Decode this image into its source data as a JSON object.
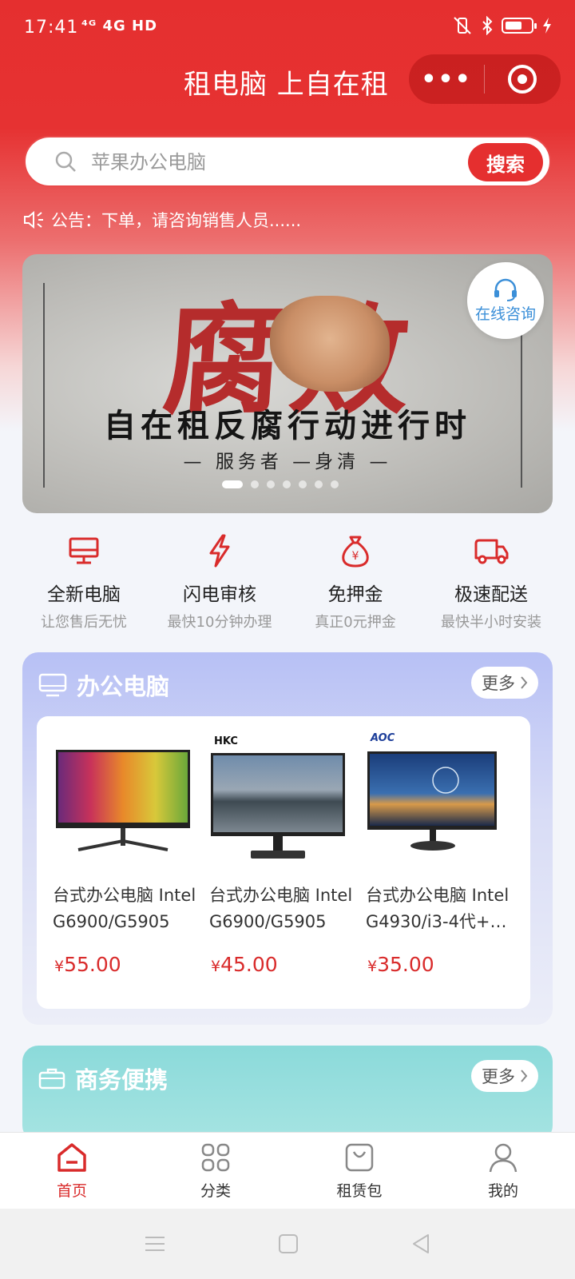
{
  "status_bar": {
    "time": "17:41",
    "network": "⁴ᴳ 4G HD",
    "colors": {
      "bg": "#e52f2f"
    }
  },
  "nav": {
    "title": "租电脑 上自在租",
    "more_glyph": "•••"
  },
  "search": {
    "placeholder": "苹果办公电脑",
    "button_label": "搜索"
  },
  "notice": {
    "text": "公告：下单，请咨询销售人员......"
  },
  "banner": {
    "headline": "腐败",
    "slogan": "自在租反腐行动进行时",
    "tagline": "— 服务者 —身清 —",
    "slide_count": 7,
    "active_slide": 0
  },
  "consult": {
    "label": "在线咨询"
  },
  "features": [
    {
      "title": "全新电脑",
      "sub": "让您售后无忧",
      "icon": "monitor-icon"
    },
    {
      "title": "闪电审核",
      "sub": "最快10分钟办理",
      "icon": "lightning-icon"
    },
    {
      "title": "免押金",
      "sub": "真正0元押金",
      "icon": "money-bag-icon"
    },
    {
      "title": "极速配送",
      "sub": "最快半小时安装",
      "icon": "delivery-truck-icon"
    }
  ],
  "office_section": {
    "title": "办公电脑",
    "more_label": "更多",
    "products": [
      {
        "name": "台式办公电脑 Intel G6900/G5905+…",
        "price": "55.00",
        "currency": "¥",
        "brand": ""
      },
      {
        "name": "台式办公电脑 Intel G6900/G5905+…",
        "price": "45.00",
        "currency": "¥",
        "brand": "HKC"
      },
      {
        "name": "台式办公电脑 Intel G4930/i3-4代+…",
        "price": "35.00",
        "currency": "¥",
        "brand": "AOC"
      }
    ]
  },
  "biz_section": {
    "title": "商务便携",
    "more_label": "更多"
  },
  "tabbar": [
    {
      "label": "首页",
      "icon": "home-icon",
      "active": true
    },
    {
      "label": "分类",
      "icon": "category-icon",
      "active": false
    },
    {
      "label": "租赁包",
      "icon": "bag-icon",
      "active": false
    },
    {
      "label": "我的",
      "icon": "user-icon",
      "active": false
    }
  ],
  "theme": {
    "accent": "#e52f2f",
    "price": "#d92b2b",
    "consult": "#3b8fd8"
  }
}
